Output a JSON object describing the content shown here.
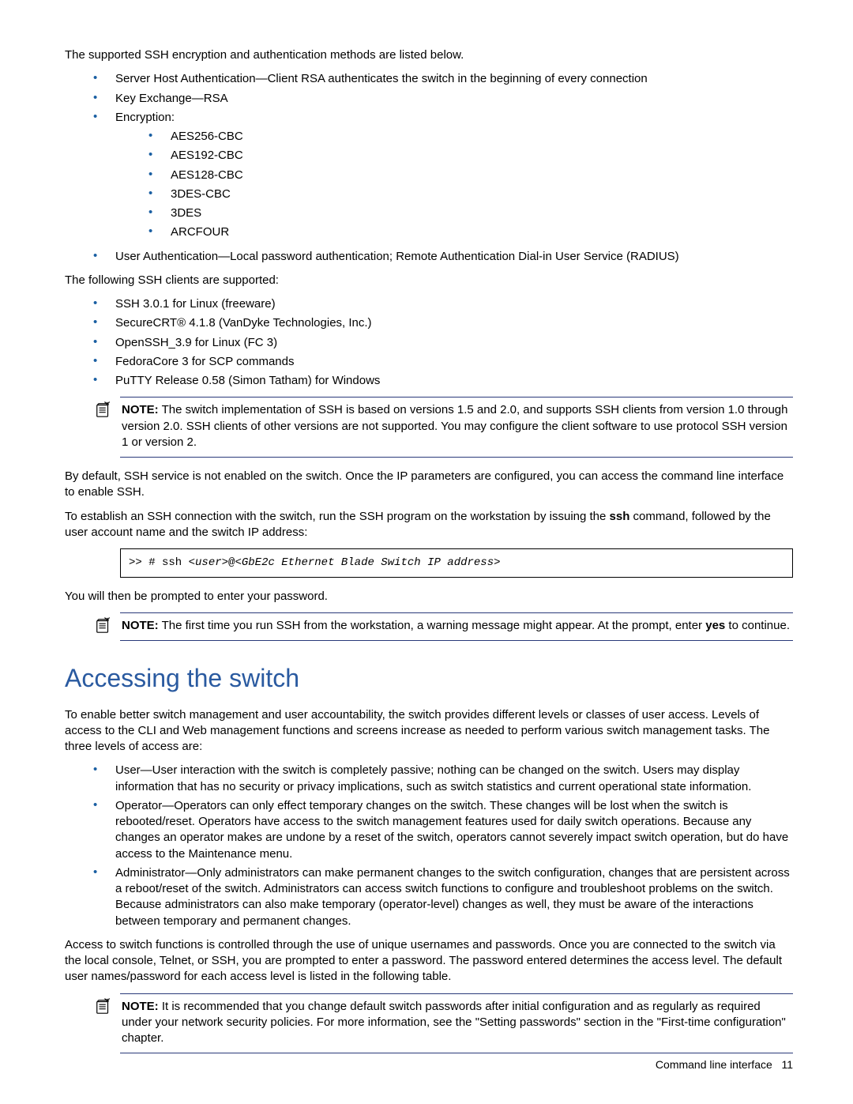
{
  "intro": "The supported SSH encryption and authentication methods are listed below.",
  "methods": {
    "server_host": "Server Host Authentication—Client RSA authenticates the switch in the beginning of every connection",
    "key_exchange": "Key Exchange—RSA",
    "encryption_label": "Encryption:",
    "encryption": {
      "aes256": "AES256-CBC",
      "aes192": "AES192-CBC",
      "aes128": "AES128-CBC",
      "tripledes_cbc": "3DES-CBC",
      "tripledes": "3DES",
      "arcfour": "ARCFOUR"
    },
    "user_auth": "User Authentication—Local password authentication; Remote Authentication Dial-in User Service (RADIUS)"
  },
  "clients_intro": "The following SSH clients are supported:",
  "clients": {
    "c1": "SSH 3.0.1 for Linux (freeware)",
    "c2": "SecureCRT® 4.1.8 (VanDyke Technologies, Inc.)",
    "c3": "OpenSSH_3.9 for Linux (FC 3)",
    "c4": "FedoraCore 3 for SCP commands",
    "c5": "PuTTY Release 0.58 (Simon Tatham) for Windows"
  },
  "note1": {
    "label": "NOTE:",
    "text": "  The switch implementation of SSH is based on versions 1.5 and 2.0, and supports SSH clients from version 1.0 through version 2.0. SSH clients of other versions are not supported. You may configure the client software to use protocol SSH version 1 or version 2."
  },
  "after_note1_p1": "By default, SSH service is not enabled on the switch. Once the IP parameters are configured, you can access the command line interface to enable SSH.",
  "after_note1_p2a": "To establish an SSH connection with the switch, run the SSH program on the workstation by issuing the ",
  "after_note1_p2b": "ssh",
  "after_note1_p2c": " command, followed by the user account name and the switch IP address:",
  "code": {
    "prefix": ">> # ssh ",
    "user_open": "<",
    "user": "user",
    "user_close": ">",
    "at": "@",
    "ip_open": "<",
    "ip": "GbE2c Ethernet Blade Switch IP address",
    "ip_close": ">"
  },
  "after_code": "You will then be prompted to enter your password.",
  "note2": {
    "label": "NOTE:",
    "text_a": "  The first time you run SSH from the workstation, a warning message might appear. At the prompt, enter ",
    "yes": "yes",
    "text_b": " to continue."
  },
  "section_title": "Accessing the switch",
  "section_para1": "To enable better switch management and user accountability, the switch provides different levels or classes of user access. Levels of access to the CLI and Web management functions and screens increase as needed to perform various switch management tasks. The three levels of access are:",
  "levels": {
    "user": "User—User interaction with the switch is completely passive; nothing can be changed on the switch. Users may display information that has no security or privacy implications, such as switch statistics and current operational state information.",
    "operator": "Operator—Operators can only effect temporary changes on the switch. These changes will be lost when the switch is rebooted/reset. Operators have access to the switch management features used for daily switch operations. Because any changes an operator makes are undone by a reset of the switch, operators cannot severely impact switch operation, but do have access to the Maintenance menu.",
    "admin": "Administrator—Only administrators can make permanent changes to the switch configuration, changes that are persistent across a reboot/reset of the switch. Administrators can access switch functions to configure and troubleshoot problems on the switch. Because administrators can also make temporary (operator-level) changes as well, they must be aware of the interactions between temporary and permanent changes."
  },
  "section_para2": "Access to switch functions is controlled through the use of unique usernames and passwords. Once you are connected to the switch via the local console, Telnet, or SSH, you are prompted to enter a password. The password entered determines the access level. The default user names/password for each access level is listed in the following table.",
  "note3": {
    "label": "NOTE:",
    "text": "  It is recommended that you change default switch passwords after initial configuration and as regularly as required under your network security policies. For more information, see the \"Setting passwords\" section in the \"First-time configuration\" chapter."
  },
  "footer": {
    "text": "Command line interface",
    "page": "11"
  }
}
